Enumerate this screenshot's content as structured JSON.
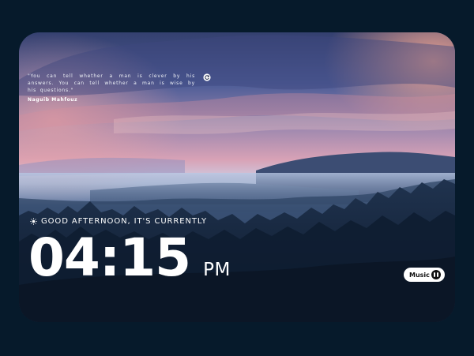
{
  "quote": {
    "text": "\"You can tell whether a man is clever by his answers. You can tell whether a man is wise by his questions.\"",
    "author": "Naguib Mahfouz",
    "refresh_icon": "refresh-icon"
  },
  "greeting": {
    "icon": "sun-icon",
    "text": "GOOD AFTERNOON, IT'S CURRENTLY"
  },
  "clock": {
    "time": "04:15",
    "period": "PM"
  },
  "music": {
    "label": "Music",
    "icon": "pause-icon"
  },
  "colors": {
    "page_background": "#061a2b",
    "text": "#ffffff",
    "button_background": "#ffffff",
    "button_icon": "#111111"
  }
}
